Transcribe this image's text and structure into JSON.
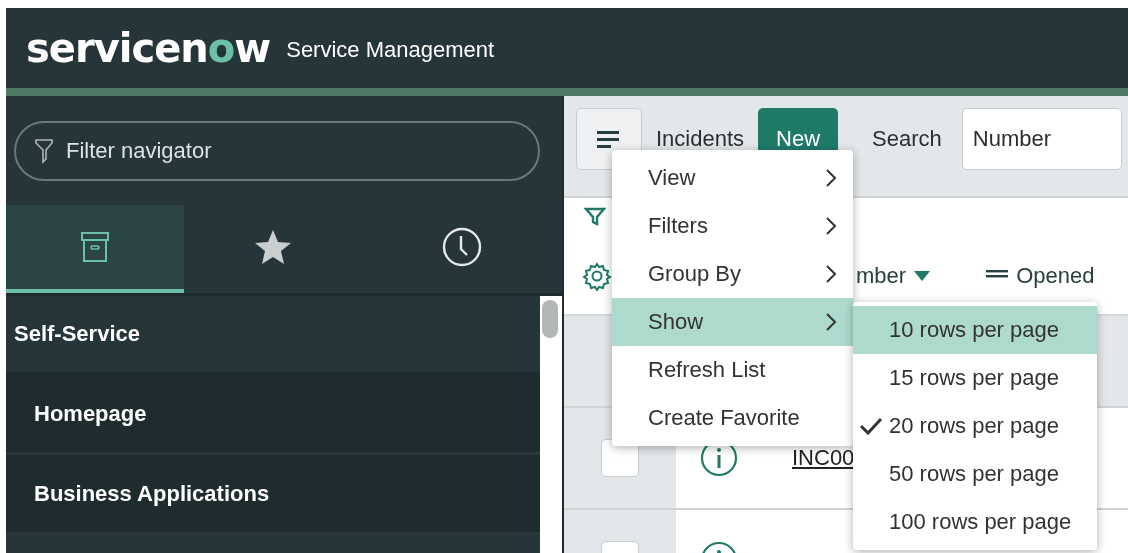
{
  "header": {
    "logo": "servicenow",
    "product": "Service Management"
  },
  "navigator": {
    "filter": {
      "placeholder": "Filter navigator"
    },
    "tabs": [
      {
        "kind": "archive",
        "selected": true
      },
      {
        "kind": "star",
        "selected": false
      },
      {
        "kind": "clock",
        "selected": false
      }
    ],
    "items": [
      {
        "label": "Self-Service",
        "kind": "section"
      },
      {
        "label": "Homepage",
        "kind": "module"
      },
      {
        "label": "Business Applications",
        "kind": "module"
      }
    ]
  },
  "list": {
    "title": "Incidents",
    "new_button": "New",
    "search_label": "Search",
    "search_field": {
      "value": "Number"
    },
    "columns": [
      {
        "label": "mber",
        "kind": "sorted"
      },
      {
        "label": "Opened",
        "kind": "menu"
      }
    ],
    "rows": [
      {
        "number": "INC00",
        "checked": false
      },
      {
        "checked": false
      }
    ]
  },
  "context_menu": {
    "items": [
      {
        "label": "View",
        "submenu": true,
        "selected": false
      },
      {
        "label": "Filters",
        "submenu": true,
        "selected": false
      },
      {
        "label": "Group By",
        "submenu": true,
        "selected": false
      },
      {
        "label": "Show",
        "submenu": true,
        "selected": true
      },
      {
        "label": "Refresh List",
        "submenu": false,
        "selected": false
      },
      {
        "label": "Create Favorite",
        "submenu": false,
        "selected": false
      }
    ]
  },
  "submenu": {
    "items": [
      {
        "label": "10 rows per page",
        "selected": true,
        "checked": false
      },
      {
        "label": "15 rows per page",
        "selected": false,
        "checked": false
      },
      {
        "label": "20 rows per page",
        "selected": false,
        "checked": true
      },
      {
        "label": "50 rows per page",
        "selected": false,
        "checked": false
      },
      {
        "label": "100 rows per page",
        "selected": false,
        "checked": false
      }
    ]
  }
}
